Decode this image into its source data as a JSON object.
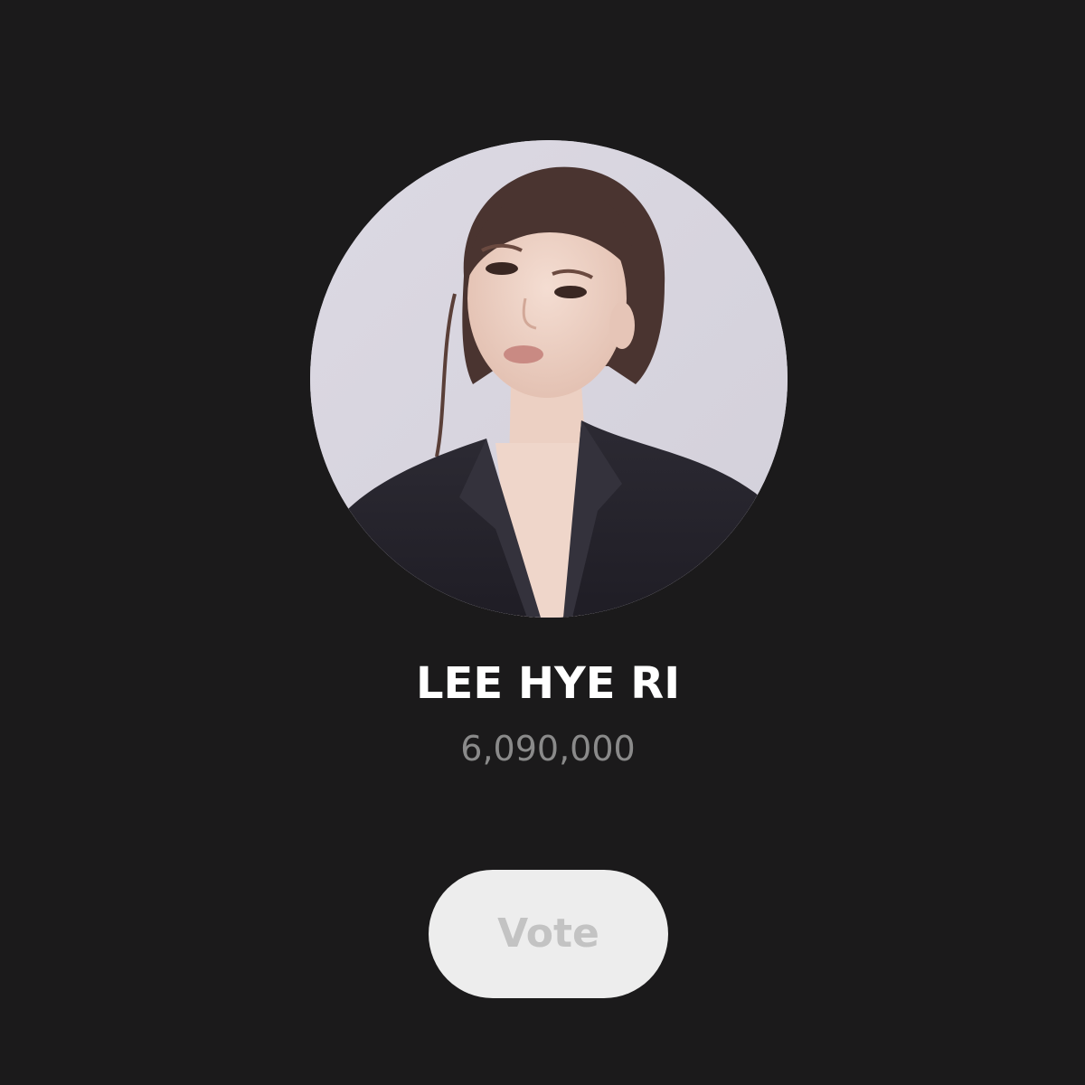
{
  "candidate": {
    "name": "LEE HYE RI",
    "vote_count": "6,090,000",
    "photo": {
      "icon": "portrait-photo",
      "background_color": "#d8d5df"
    }
  },
  "actions": {
    "vote_label": "Vote"
  },
  "colors": {
    "page_background": "#1b1a1b",
    "name_text": "#ffffff",
    "count_text": "#8a8a8a",
    "vote_button_background": "#ededed",
    "vote_button_text": "#c3c3c3"
  }
}
